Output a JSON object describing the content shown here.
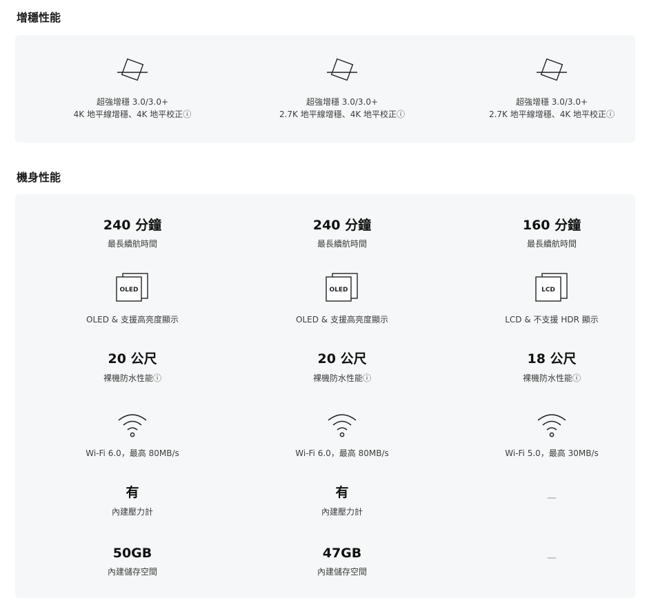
{
  "stabilization": {
    "title": "增穩性能",
    "columns": [
      {
        "icon": "horizon-tilt-icon",
        "line1": "超強增穩 3.0/3.0+",
        "line2": "4K 地平線增穩、4K 地平校正ⓘ"
      },
      {
        "icon": "horizon-tilt-icon",
        "line1": "超強增穩 3.0/3.0+",
        "line2": "2.7K 地平線增穩、4K 地平校正ⓘ"
      },
      {
        "icon": "horizon-tilt-icon",
        "line1": "超強增穩 3.0/3.0+",
        "line2": "2.7K 地平線增穩、4K 地平校正ⓘ"
      }
    ]
  },
  "body_performance": {
    "title": "機身性能",
    "columns": [
      {
        "battery_value": "240 分鐘",
        "battery_label": "最長續航時間",
        "screen_icon": "oled-screen-icon",
        "screen_badge": "OLED",
        "screen_label": "OLED & 支援高亮度顯示",
        "water_value": "20 公尺",
        "water_label": "裸機防水性能ⓘ",
        "wifi_icon": "wifi-icon",
        "wifi_label": "Wi-Fi 6.0，最高 80MB/s",
        "barometer_value": "有",
        "barometer_label": "內建壓力計",
        "storage_value": "50GB",
        "storage_label": "內建儲存空間"
      },
      {
        "battery_value": "240 分鐘",
        "battery_label": "最長續航時間",
        "screen_icon": "oled-screen-icon",
        "screen_badge": "OLED",
        "screen_label": "OLED & 支援高亮度顯示",
        "water_value": "20 公尺",
        "water_label": "裸機防水性能ⓘ",
        "wifi_icon": "wifi-icon",
        "wifi_label": "Wi-Fi 6.0，最高 80MB/s",
        "barometer_value": "有",
        "barometer_label": "內建壓力計",
        "storage_value": "47GB",
        "storage_label": "內建儲存空間"
      },
      {
        "battery_value": "160 分鐘",
        "battery_label": "最長續航時間",
        "screen_icon": "lcd-screen-icon",
        "screen_badge": "LCD",
        "screen_label": "LCD & 不支援 HDR 顯示",
        "water_value": "18 公尺",
        "water_label": "裸機防水性能ⓘ",
        "wifi_icon": "wifi-icon",
        "wifi_label": "Wi-Fi 5.0，最高 30MB/s",
        "barometer_value": "—",
        "barometer_label": "",
        "storage_value": "—",
        "storage_label": ""
      }
    ]
  }
}
